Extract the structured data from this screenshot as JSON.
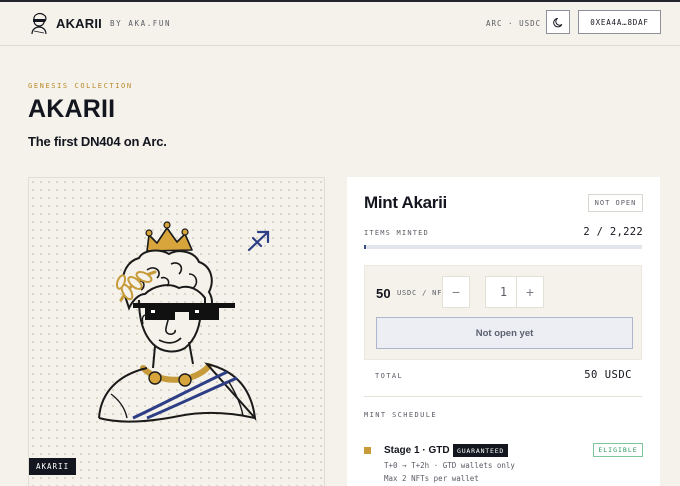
{
  "header": {
    "brand": "AKARII",
    "byline": "BY AKA.FUN",
    "network": "ARC · USDC",
    "theme_icon": "moon-icon",
    "wallet": "0XEA4A…8DAF"
  },
  "hero": {
    "eyebrow": "GENESIS COLLECTION",
    "title": "AKARII",
    "subtitle": "The first DN404 on Arc."
  },
  "artwork": {
    "tag": "AKARII",
    "accent_gold": "#c79a3a",
    "accent_blue": "#2d3e86"
  },
  "mint": {
    "title": "Mint Akarii",
    "status": "NOT OPEN",
    "items_label": "ITEMS MINTED",
    "items_count": "2 / 2,222",
    "progress_fraction": 0.0009,
    "price": "50",
    "price_unit": "USDC / NFT",
    "decrement": "−",
    "quantity": "1",
    "increment": "+",
    "button_label": "Not open yet",
    "total_label": "TOTAL",
    "total_value": "50 USDC",
    "schedule_label": "MINT SCHEDULE",
    "stage": {
      "name": "Stage 1 · GTD",
      "badge": "GUARANTEED",
      "eligibility": "ELIGIBLE",
      "timing": "T+0 → T+2h · GTD wallets only",
      "limit": "Max 2 NFTs per wallet"
    }
  }
}
